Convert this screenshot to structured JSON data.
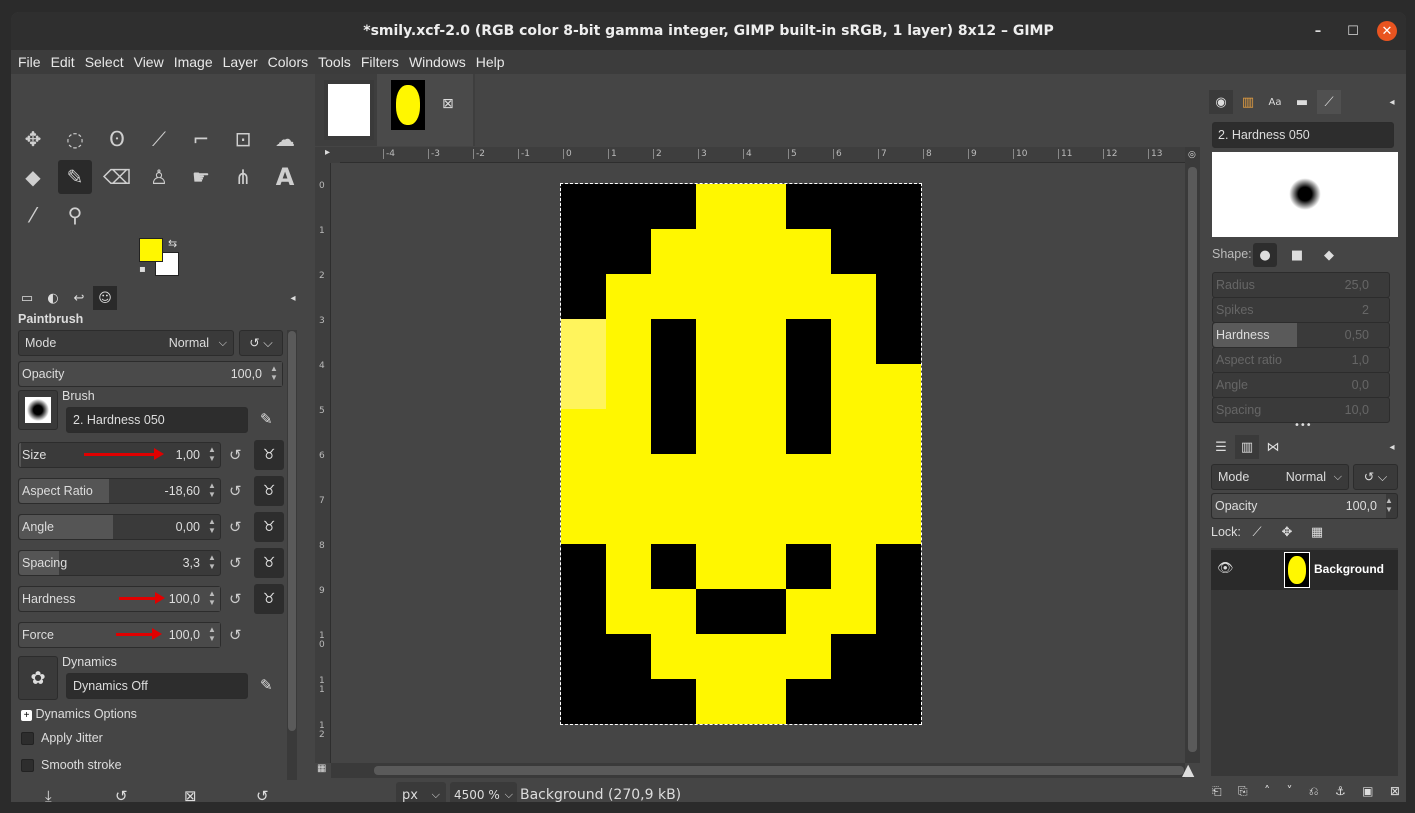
{
  "window": {
    "title": "*smily.xcf-2.0 (RGB color 8-bit gamma integer, GIMP built-in sRGB, 1 layer) 8x12 – GIMP"
  },
  "menu": [
    "File",
    "Edit",
    "Select",
    "View",
    "Image",
    "Layer",
    "Colors",
    "Tools",
    "Filters",
    "Windows",
    "Help"
  ],
  "colors": {
    "fg": "#fff700",
    "bg": "#ffffff",
    "accent_red": "#e00000",
    "yellow": "#fff700",
    "light_yellow": "#fff45c",
    "black": "#000000"
  },
  "toolbox_icons": [
    "move-icon",
    "ellipse-select-icon",
    "free-select-icon",
    "fuzzy-select-icon",
    "crop-icon",
    "unified-transform-icon",
    "warp-icon",
    "bucket-fill-icon",
    "paintbrush-icon",
    "eraser-icon",
    "clone-icon",
    "smudge-icon",
    "paths-icon",
    "text-icon",
    "color-picker-icon",
    "zoom-icon"
  ],
  "tool_options": {
    "title": "Paintbrush",
    "mode_label": "Mode",
    "mode_value": "Normal",
    "opacity_label": "Opacity",
    "opacity_value": "100,0",
    "brush_label": "Brush",
    "brush_name": "2. Hardness 050",
    "size_label": "Size",
    "size_value": "1,00",
    "aspect_label": "Aspect Ratio",
    "aspect_value": "-18,60",
    "angle_label": "Angle",
    "angle_value": "0,00",
    "spacing_label": "Spacing",
    "spacing_value": "3,3",
    "hardness_label": "Hardness",
    "hardness_value": "100,0",
    "force_label": "Force",
    "force_value": "100,0",
    "dynamics_label": "Dynamics",
    "dynamics_value": "Dynamics Off",
    "dynamics_options": "Dynamics Options",
    "apply_jitter": "Apply Jitter",
    "smooth_stroke": "Smooth stroke"
  },
  "canvas": {
    "ruler_h": [
      "-4",
      "-3",
      "-2",
      "-1",
      "0",
      "1",
      "2",
      "3",
      "4",
      "5",
      "6",
      "7",
      "8",
      "9",
      "10",
      "11",
      "12",
      "13"
    ],
    "ruler_v": [
      "0",
      "1",
      "2",
      "3",
      "4",
      "5",
      "6",
      "7",
      "8",
      "9",
      "1\n0",
      "1\n1",
      "1\n2"
    ],
    "pixels": [
      "KKKYYKKK",
      "KKYYYYKK",
      "KYYYYYYK",
      "LYKYYKYK",
      "LYKYYKYY",
      "YYKYYKYY",
      "YYYYYYYY",
      "YYYYYYYY",
      "KYKYYKYK",
      "KYYKKYYK",
      "KKYYYYKK",
      "KKKYYKKK"
    ]
  },
  "status": {
    "unit": "px",
    "zoom": "4500 %",
    "info": "Background (270,9 kB)"
  },
  "brushes_panel": {
    "brush_name": "2. Hardness 050",
    "shape_label": "Shape:",
    "radius_label": "Radius",
    "radius_value": "25,0",
    "spikes_label": "Spikes",
    "spikes_value": "2",
    "hardness_label": "Hardness",
    "hardness_value": "0,50",
    "aspect_label": "Aspect ratio",
    "aspect_value": "1,0",
    "angle_label": "Angle",
    "angle_value": "0,0",
    "spacing_label": "Spacing",
    "spacing_value": "10,0"
  },
  "layers_panel": {
    "mode_label": "Mode",
    "mode_value": "Normal",
    "opacity_label": "Opacity",
    "opacity_value": "100,0",
    "lock_label": "Lock:",
    "layer_name": "Background"
  }
}
